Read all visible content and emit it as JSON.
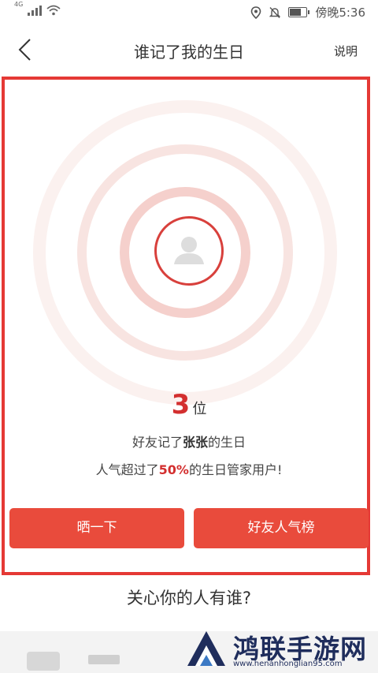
{
  "status_bar": {
    "network": "4G",
    "time": "傍晚5:36",
    "icons": [
      "signal-icon",
      "wifi-icon",
      "location-icon",
      "bell-muted-icon",
      "battery-icon"
    ]
  },
  "nav": {
    "title": "谁记了我的生日",
    "help_label": "说明",
    "back_icon": "chevron-left-icon"
  },
  "result": {
    "count": "3",
    "count_unit": "位",
    "line1_prefix": "好友记了",
    "line1_name": "张张",
    "line1_suffix": "的生日",
    "line2_prefix": "人气超过了",
    "line2_percent": "50%",
    "line2_suffix": "的生日管家用户!"
  },
  "buttons": {
    "share_label": "晒一下",
    "ranking_label": "好友人气榜"
  },
  "section": {
    "title": "关心你的人有谁?"
  },
  "watermark": {
    "name": "鸿联手游网",
    "url": "www.henanhonglian95.com"
  },
  "colors": {
    "accent": "#e94b3c",
    "frame": "#e53935",
    "highlight": "#d32f2f"
  }
}
